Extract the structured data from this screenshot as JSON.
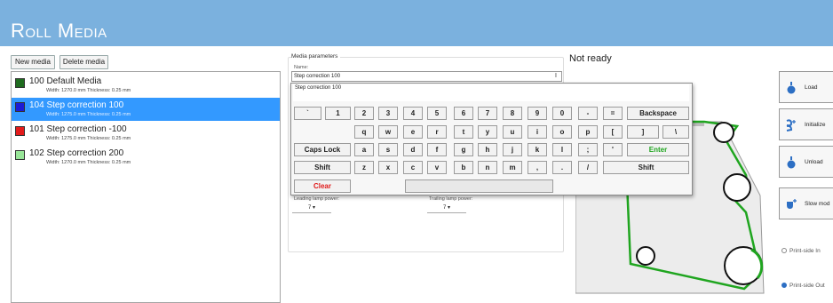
{
  "app": {
    "title": "Roll Media"
  },
  "toolbar": {
    "new_media": "New media",
    "delete_media": "Delete media"
  },
  "media_list": [
    {
      "name": "100 Default Media",
      "details": "Width: 1270.0 mm  Thickness: 0.25 mm",
      "color": "#1f6b1f",
      "selected": false
    },
    {
      "name": "104 Step correction 100",
      "details": "Width: 1275.0 mm  Thickness: 0.25 mm",
      "color": "#1c1cd6",
      "selected": true
    },
    {
      "name": "101 Step correction -100",
      "details": "Width: 1275.0 mm  Thickness: 0.25 mm",
      "color": "#e31b1b",
      "selected": false
    },
    {
      "name": "102 Step correction 200",
      "details": "Width: 1270.0 mm  Thickness: 0.25 mm",
      "color": "#98e598",
      "selected": false
    }
  ],
  "params": {
    "group_label": "Media parameters",
    "name_label": "Name:",
    "name_value": "Step correction 100",
    "leading_label": "Leading lamp power:",
    "leading_value": "7 ▾",
    "trailing_label": "Trailing lamp power:",
    "trailing_value": "7 ▾"
  },
  "status": {
    "text": "Not ready"
  },
  "keyboard": {
    "preview": "Step correction 100",
    "rows": [
      [
        "`",
        "1",
        "2",
        "3",
        "4",
        "5",
        "6",
        "7",
        "8",
        "9",
        "0",
        "-",
        "=",
        "Backspace"
      ],
      [
        "q",
        "w",
        "e",
        "r",
        "t",
        "y",
        "u",
        "i",
        "o",
        "p",
        "[",
        "]",
        "\\"
      ],
      [
        "Caps Lock",
        "a",
        "s",
        "d",
        "f",
        "g",
        "h",
        "j",
        "k",
        "l",
        ";",
        "'",
        "Enter"
      ],
      [
        "Shift",
        "z",
        "x",
        "c",
        "v",
        "b",
        "n",
        "m",
        ",",
        ".",
        "/",
        "Shift"
      ],
      [
        "Clear",
        ""
      ]
    ]
  },
  "side_buttons": [
    {
      "label": "Load",
      "icon": "load-icon"
    },
    {
      "label": "Initialize",
      "icon": "initialize-icon"
    },
    {
      "label": "Unload",
      "icon": "unload-icon"
    },
    {
      "label": "Slow mod",
      "icon": "slow-mode-icon"
    }
  ],
  "print_side": {
    "in_label": "Print-side In",
    "out_label": "Print-side Out",
    "selected": "out"
  },
  "colors": {
    "titlebar": "#7bb1de",
    "selection": "#3399ff",
    "media_path": "#1fa51f",
    "accent": "#2d6fc4"
  }
}
